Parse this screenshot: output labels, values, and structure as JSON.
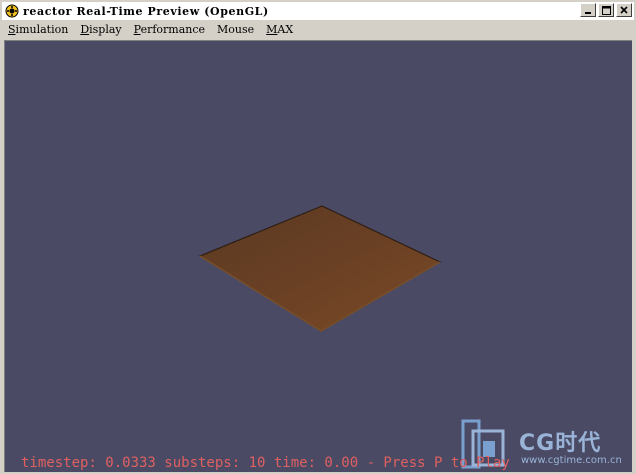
{
  "window": {
    "title": "reactor Real-Time Preview (OpenGL)",
    "buttons": [
      "minimize",
      "maximize",
      "close"
    ]
  },
  "menu": [
    {
      "label": "Simulation",
      "mnemonic": "S"
    },
    {
      "label": "Display",
      "mnemonic": "D"
    },
    {
      "label": "Performance",
      "mnemonic": "P"
    },
    {
      "label": "Mouse",
      "mnemonic": ""
    },
    {
      "label": "MAX",
      "mnemonic": "M"
    }
  ],
  "viewport": {
    "background_color": "#4a4a64",
    "plane_color": "#6b3f20",
    "status_line": "timestep: 0.0333 substeps: 10 time: 0.00 - Press  P  to Play"
  },
  "watermark": {
    "text": "CG时代",
    "url": "www.cgtime.com.cn"
  },
  "icons": {
    "app": "reactor-icon",
    "minimize": "minimize-icon",
    "maximize": "maximize-icon",
    "close": "close-icon"
  }
}
